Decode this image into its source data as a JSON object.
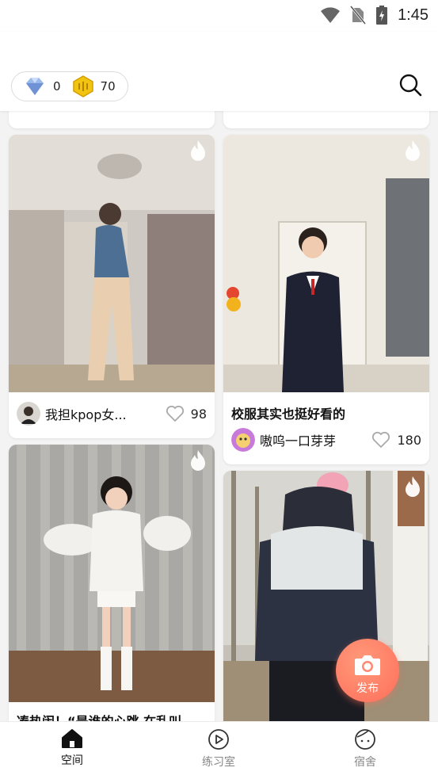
{
  "status_bar": {
    "time": "1:45"
  },
  "currency": {
    "diamond_count": "0",
    "coin_count": "70"
  },
  "feed": {
    "cards": [
      {
        "author": "我担kpop女...",
        "likes": "98"
      },
      {
        "title": "校服其实也挺好看的",
        "author": "嗷呜一口芽芽",
        "likes": "180"
      },
      {
        "title": "凑热闹！“是谁的心跳 在乱叫"
      },
      {}
    ]
  },
  "fab": {
    "label": "发布"
  },
  "nav": {
    "items": [
      {
        "label": "空间"
      },
      {
        "label": "练习室"
      },
      {
        "label": "宿舍"
      }
    ]
  },
  "colors": {
    "accent": "#ff7a63",
    "active_nav": "#111111",
    "inactive_nav": "#888888"
  }
}
